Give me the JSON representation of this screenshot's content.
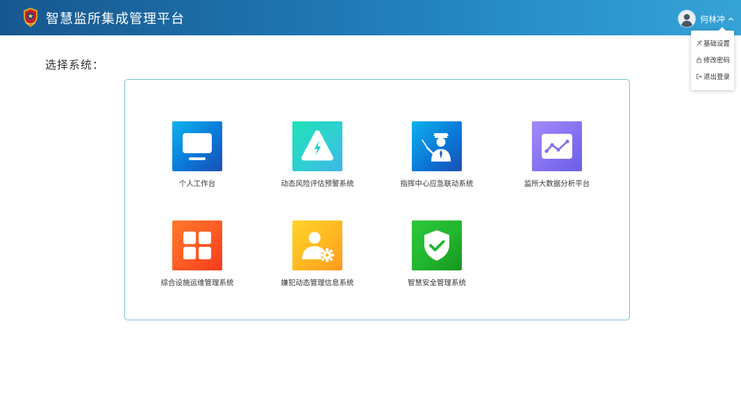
{
  "header": {
    "title": "智慧监所集成管理平台",
    "user_name": "何林冲"
  },
  "user_menu": {
    "items": [
      {
        "label": "基础设置",
        "icon": "tools-icon"
      },
      {
        "label": "修改密码",
        "icon": "lock-icon"
      },
      {
        "label": "退出登录",
        "icon": "logout-icon"
      }
    ]
  },
  "main": {
    "section_label": "选择系统：",
    "systems": [
      {
        "label": "个人工作台",
        "icon": "monitor-icon",
        "color": "#0a78d8"
      },
      {
        "label": "动态风险评估预警系统",
        "icon": "warning-bolt-icon",
        "color": "#2fcfd2"
      },
      {
        "label": "指挥中心应急联动系统",
        "icon": "officer-icon",
        "color": "#0a78d8"
      },
      {
        "label": "监所大数据分析平台",
        "icon": "line-chart-icon",
        "color": "#8571f2"
      },
      {
        "label": "综合设施运维管理系统",
        "icon": "grid-icon",
        "color": "#ff5a23"
      },
      {
        "label": "嫌犯动态管理信息系统",
        "icon": "user-gear-icon",
        "color": "#ffb722"
      },
      {
        "label": "智慧安全管理系统",
        "icon": "shield-check-icon",
        "color": "#22b52e"
      }
    ]
  }
}
